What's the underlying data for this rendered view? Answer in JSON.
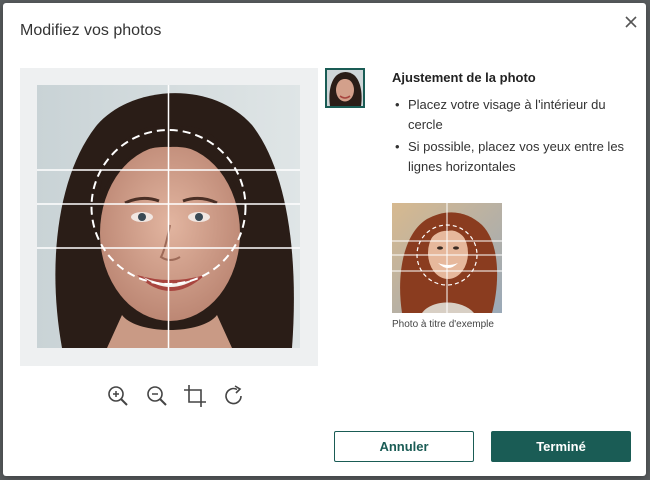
{
  "dialog": {
    "title": "Modifiez vos photos",
    "close_icon": "close-icon"
  },
  "editor": {
    "tools": [
      {
        "name": "zoom-in-icon"
      },
      {
        "name": "zoom-out-icon"
      },
      {
        "name": "crop-icon"
      },
      {
        "name": "rotate-icon"
      }
    ]
  },
  "guidance": {
    "heading": "Ajustement de la photo",
    "tips": [
      "Placez votre visage à l'intérieur du cercle",
      "Si possible, placez vos yeux entre les lignes horizontales"
    ],
    "example_caption": "Photo à titre d'exemple"
  },
  "actions": {
    "cancel_label": "Annuler",
    "done_label": "Terminé"
  },
  "colors": {
    "accent": "#1a5c55",
    "editor_bg": "#eef0f1"
  }
}
